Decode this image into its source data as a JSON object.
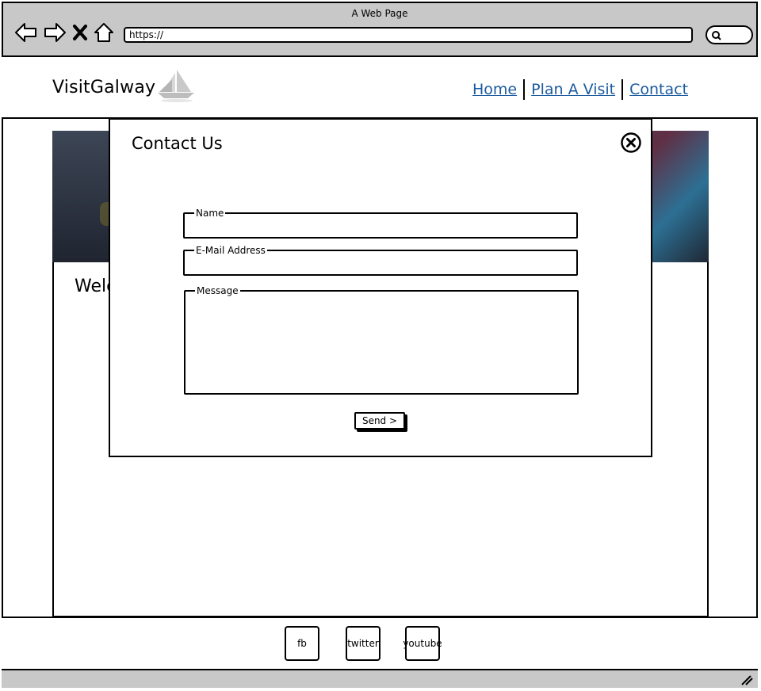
{
  "browser": {
    "title": "A Web Page",
    "url": "https://",
    "icons": [
      "back-arrow-icon",
      "forward-arrow-icon",
      "close-x-icon",
      "home-icon",
      "search-icon"
    ]
  },
  "site": {
    "logo_text": "VisitGalway",
    "nav": [
      "Home",
      "Plan A Visit",
      "Contact"
    ],
    "welcome_partial": "Welc"
  },
  "modal": {
    "title": "Contact Us",
    "fields": {
      "name_label": "Name",
      "name_value": "",
      "email_label": "E-Mail Address",
      "email_value": "",
      "message_label": "Message",
      "message_value": ""
    },
    "send_label": "Send >"
  },
  "footer": {
    "social": [
      "fb",
      "twitter",
      "youtube"
    ]
  },
  "colors": {
    "link": "#1a5a9e",
    "chrome": "#c8c8c8"
  }
}
